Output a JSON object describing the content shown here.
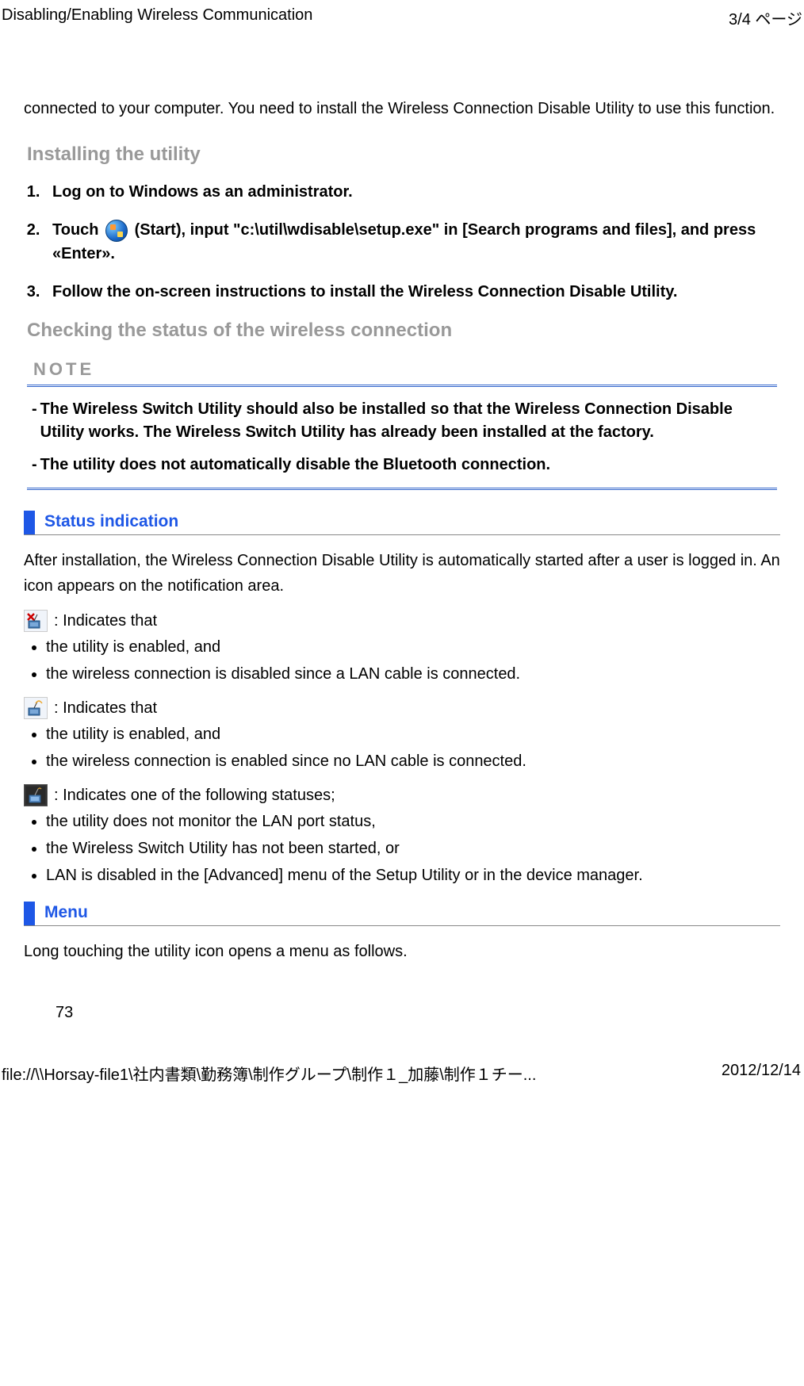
{
  "header": {
    "title": "Disabling/Enabling Wireless Communication",
    "page_indicator": "3/4 ページ"
  },
  "intro": "connected to your computer. You need to install the Wireless Connection Disable Utility to use this function.",
  "section_install": {
    "heading": "Installing the utility",
    "steps": [
      "Log on to Windows as an administrator.",
      "Touch ",
      " (Start), input \"c:\\util\\wdisable\\setup.exe\" in [Search programs and files], and press «Enter».",
      "Follow the on-screen instructions to install the Wireless Connection Disable Utility."
    ]
  },
  "section_check": {
    "heading": "Checking the status of the wireless connection"
  },
  "note": {
    "label": "NOTE",
    "items": [
      "The Wireless Switch Utility should also be installed so that the Wireless Connection Disable Utility works. The Wireless Switch Utility has already been installed at the factory.",
      "The utility does not automatically disable the Bluetooth connection."
    ]
  },
  "status_section": {
    "heading": "Status indication",
    "intro": "After installation, the Wireless Connection Disable Utility is automatically started after a user is logged in. An icon appears on the notification area.",
    "icon1_label": " : Indicates that",
    "icon1_bullets": [
      "the utility is enabled, and",
      "the wireless connection is disabled since a LAN cable is connected."
    ],
    "icon2_label": " : Indicates that",
    "icon2_bullets": [
      "the utility is enabled, and",
      "the wireless connection is enabled since no LAN cable is connected."
    ],
    "icon3_label": " : Indicates one of the following statuses;",
    "icon3_bullets": [
      "the utility does not monitor the LAN port status,",
      "the Wireless Switch Utility has not been started, or",
      "LAN is disabled in the [Advanced] menu of the Setup Utility or in the device manager."
    ]
  },
  "menu_section": {
    "heading": "Menu",
    "text": "Long touching the utility icon opens a menu as follows."
  },
  "page_number": "73",
  "footer": {
    "path": "file://\\\\Horsay-file1\\社内書類\\勤務簿\\制作グループ\\制作１_加藤\\制作１チー...",
    "date": "2012/12/14"
  }
}
